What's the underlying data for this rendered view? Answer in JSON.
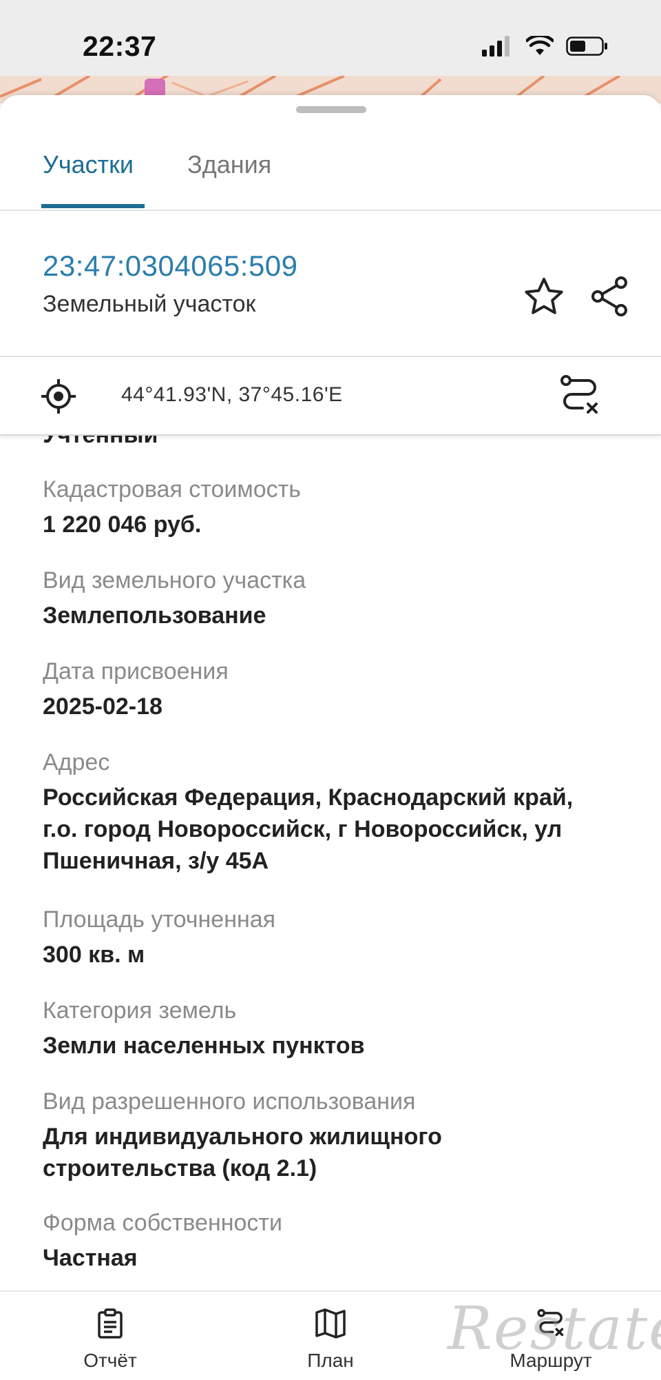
{
  "status_bar": {
    "time": "22:37"
  },
  "tabs": [
    {
      "label": "Участки",
      "active": true
    },
    {
      "label": "Здания",
      "active": false
    }
  ],
  "parcel": {
    "cadastral_number": "23:47:0304065:509",
    "object_type": "Земельный участок"
  },
  "coordinates": "44°41.93'N, 37°45.16'E",
  "details": {
    "partial_value": "Учтенный",
    "fields": [
      {
        "label": "Кадастровая стоимость",
        "value": "1 220 046 руб."
      },
      {
        "label": "Вид земельного участка",
        "value": "Землепользование"
      },
      {
        "label": "Дата присвоения",
        "value": "2025-02-18"
      },
      {
        "label": "Адрес",
        "value": "Российская Федерация, Краснодарский край, г.о. город Новороссийск, г Новороссийск, ул Пшеничная, з/у 45А"
      },
      {
        "label": "Площадь уточненная",
        "value": "300 кв. м"
      },
      {
        "label": "Категория земель",
        "value": "Земли населенных пунктов"
      },
      {
        "label": "Вид разрешенного использования",
        "value": "Для индивидуального жилищного строительства (код 2.1)"
      },
      {
        "label": "Форма собственности",
        "value": "Частная"
      }
    ]
  },
  "bottom_nav": {
    "report_label": "Отчёт",
    "plan_label": "План",
    "route_label": "Маршрут"
  },
  "watermark": "Restate",
  "colors": {
    "accent": "#1c6c94",
    "link": "#2a7dac",
    "label_gray": "#8a8a8a"
  },
  "icons": [
    "signal-icon",
    "wifi-icon",
    "battery-icon",
    "star-icon",
    "share-icon",
    "locate-icon",
    "route-clear-icon",
    "clipboard-icon",
    "map-icon"
  ]
}
